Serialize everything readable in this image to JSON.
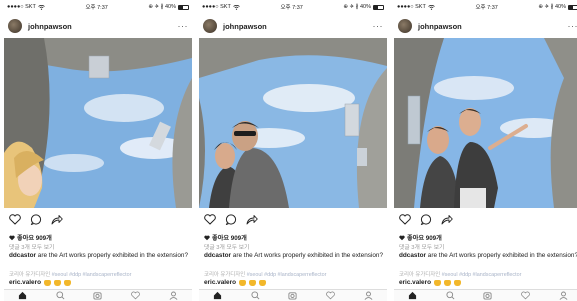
{
  "status_bar": {
    "carrier": "●●●●○ SKT",
    "wifi_icon": "wifi-icon",
    "time": "오후 7:37",
    "right": "⊕ ✈ ∦ 40%",
    "battery_level": 0.4
  },
  "post": {
    "username": "johnpawson",
    "more_label": "···",
    "likes": "좋아요 909개",
    "view_all_comments": "댓글 3개 모두 보기",
    "caption_user": "ddcastor",
    "caption_text": "are the Art works properly exhibited in the extension?",
    "tags_korean": "코리아 유가디자인",
    "tags_hashtags": "#seoul #ddp #landscaperreflector",
    "comment_user": "eric.valero",
    "comment_emoji": "clapping-hands-emoji ×3"
  },
  "actions": [
    "heart-icon",
    "comment-icon",
    "share-icon"
  ],
  "tabbar": [
    "home-icon",
    "search-icon",
    "camera-icon",
    "activity-heart-icon",
    "profile-icon"
  ],
  "photos": [
    {
      "name": "photo-woman-selfie"
    },
    {
      "name": "photo-couple-selfie"
    },
    {
      "name": "photo-two-men-selfie"
    }
  ],
  "colors": {
    "sky": "#7fb0e0",
    "building": "#8c8c86",
    "hashtag": "#a9b4c8",
    "clap": "#f2b72a"
  }
}
